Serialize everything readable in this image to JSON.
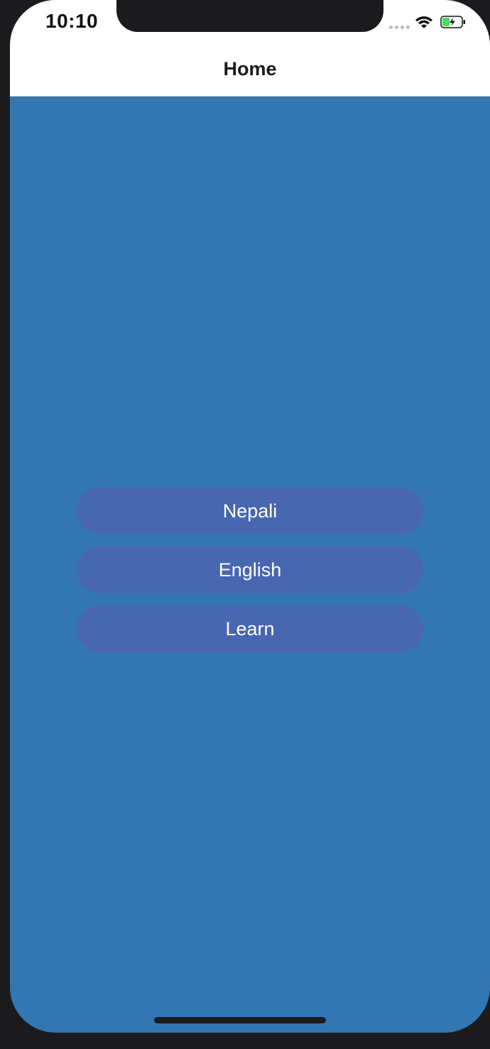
{
  "status_bar": {
    "time": "10:10"
  },
  "nav": {
    "title": "Home"
  },
  "buttons": {
    "nepali": "Nepali",
    "english": "English",
    "learn": "Learn"
  },
  "colors": {
    "background": "#3277b2",
    "button": "#4967b0",
    "nav_bar": "#ffffff",
    "battery_green": "#4cd964"
  }
}
